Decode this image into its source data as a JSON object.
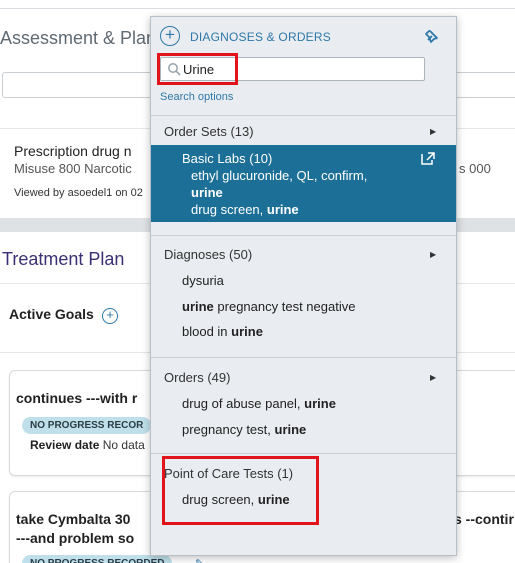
{
  "background": {
    "assessment_title": "Assessment & Plan",
    "prescription_title": "Prescription drug n",
    "prescription_line": "Misuse 800    Narcotic",
    "prescription_right": "s 000",
    "viewed_by": "Viewed by asoedel1 on 02",
    "treatment_plan_title": "Treatment Plan",
    "active_goals_label": "Active Goals",
    "card1": {
      "title": "continues ---with r",
      "badge": "NO PROGRESS RECOR",
      "review_label": "Review date",
      "review_value": "No data"
    },
    "card2": {
      "title_line1": "take Cymbalta 30",
      "title_line2": "---and problem so",
      "right_text": "s --contir",
      "badge": "NO PROGRESS RECORDED"
    }
  },
  "popup": {
    "title": "DIAGNOSES & ORDERS",
    "search": {
      "value": "Urine",
      "placeholder": ""
    },
    "search_options": "Search options",
    "sections": {
      "order_sets": {
        "header": "Order Sets (13)",
        "selected": {
          "title": "Basic Labs (10)",
          "line1": "ethyl glucuronide, QL, confirm,",
          "line2_bold": "urine",
          "line3": "drug screen, ",
          "line3_bold": "urine"
        }
      },
      "diagnoses": {
        "header": "Diagnoses (50)",
        "items": [
          {
            "pre": "dysuria",
            "bold": "",
            "post": ""
          },
          {
            "pre": "",
            "bold": "urine",
            "post": " pregnancy test negative"
          },
          {
            "pre": "blood in ",
            "bold": "urine",
            "post": ""
          }
        ]
      },
      "orders": {
        "header": "Orders (49)",
        "items": [
          {
            "pre": "drug of abuse panel, ",
            "bold": "urine"
          },
          {
            "pre": "pregnancy test, ",
            "bold": "urine"
          }
        ]
      },
      "poc": {
        "header": "Point of Care Tests (1)",
        "items": [
          {
            "pre": "drug screen, ",
            "bold": "urine"
          }
        ]
      }
    },
    "colors": {
      "accent": "#2e78a8",
      "highlight": "#1c6f96",
      "annotation_red": "#e3131b"
    }
  }
}
